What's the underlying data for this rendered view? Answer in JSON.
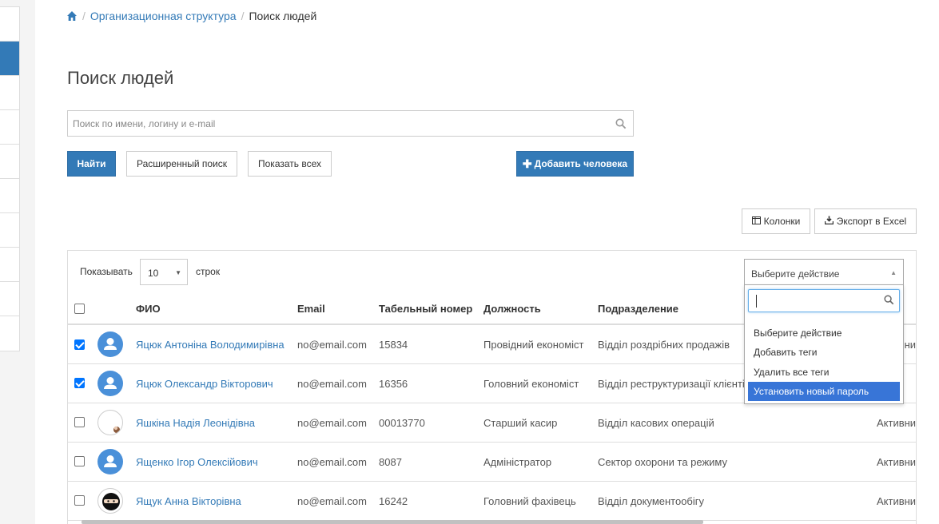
{
  "breadcrumb": {
    "home_icon": "home-icon",
    "parent": "Организационная структура",
    "current": "Поиск людей"
  },
  "page_title": "Поиск людей",
  "search": {
    "placeholder": "Поиск по имени, логину и e-mail",
    "value": ""
  },
  "buttons": {
    "find": "Найти",
    "advanced": "Расширенный поиск",
    "show_all": "Показать всех",
    "add_person": "Добавить человека",
    "columns": "Колонки",
    "export": "Экспорт в Excel"
  },
  "table_controls": {
    "show_label": "Показывать",
    "length_value": "10",
    "rows_label": "строк"
  },
  "action_select": {
    "value": "Выберите действие",
    "search_value": "",
    "options": [
      "Выберите действие",
      "Добавить теги",
      "Удалить все теги",
      "Установить новый пароль"
    ],
    "highlighted": "Установить новый пароль"
  },
  "columns": [
    "ФИО",
    "Email",
    "Табельный номер",
    "Должность",
    "Подразделение"
  ],
  "rows": [
    {
      "checked": true,
      "avatar": "default",
      "name": "Яцюк Антоніна Володимирівна",
      "email": "no@email.com",
      "tab": "15834",
      "position": "Провідний економіст",
      "dept": "Відділ роздрібних продажів",
      "status": "Активни"
    },
    {
      "checked": true,
      "avatar": "default",
      "name": "Яцюк Олександр Вікторович",
      "email": "no@email.com",
      "tab": "16356",
      "position": "Головний економіст",
      "dept": "Відділ реструктуризації клієнтів",
      "status": ""
    },
    {
      "checked": false,
      "avatar": "photo",
      "name": "Яшкіна Надія Леонідівна",
      "email": "no@email.com",
      "tab": "00013770",
      "position": "Старший касир",
      "dept": "Відділ касових операцій",
      "status": "Активни"
    },
    {
      "checked": false,
      "avatar": "default",
      "name": "Ященко Ігор Олексійович",
      "email": "no@email.com",
      "tab": "8087",
      "position": "Адміністратор",
      "dept": "Сектор охорони та режиму",
      "status": "Активни"
    },
    {
      "checked": false,
      "avatar": "ninja",
      "name": "Ящук Анна Вікторівна",
      "email": "no@email.com",
      "tab": "16242",
      "position": "Головний фахівець",
      "dept": "Відділ документообігу",
      "status": "Активни"
    }
  ],
  "colors": {
    "accent": "#337ab7",
    "highlight": "#3875d7",
    "checkbox": "#0075ff"
  }
}
